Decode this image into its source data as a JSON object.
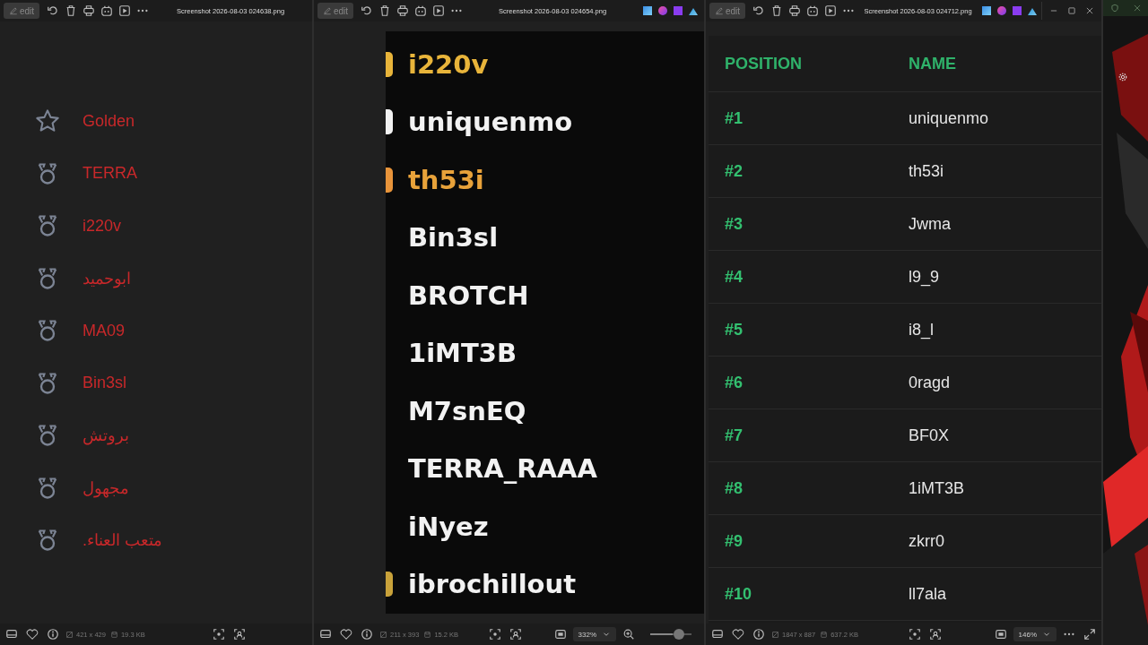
{
  "windows": [
    {
      "kind": "medals",
      "title": "Screenshot 2026-08-03 024638.png",
      "edit_label": "edit",
      "entries": [
        {
          "kind": "star",
          "name": "Golden"
        },
        {
          "kind": "medal",
          "name": "TERRA"
        },
        {
          "kind": "medal",
          "name": "i220v"
        },
        {
          "kind": "medal",
          "name": "ابوحميد"
        },
        {
          "kind": "medal",
          "name": "MA09"
        },
        {
          "kind": "medal",
          "name": "Bin3sl"
        },
        {
          "kind": "medal",
          "name": "بروتش"
        },
        {
          "kind": "medal",
          "name": "مجهول"
        },
        {
          "kind": "medal",
          "name": "متعب العناء."
        }
      ],
      "dimensions": "421 x 429",
      "file_size": "19.3 KB"
    },
    {
      "kind": "names",
      "title": "Screenshot 2026-08-03 024654.png",
      "edit_label": "edit",
      "app_shortcuts": true,
      "names": [
        {
          "name": "i220v",
          "color": "#e8b43a",
          "badge": {
            "color": "#e8b43a"
          }
        },
        {
          "name": "uniquenmo",
          "color": "#f2f2f2",
          "badge": {
            "color": "#f2f2f2"
          }
        },
        {
          "name": "th53i",
          "color": "#e8a23a",
          "badge": {
            "color": "#e8943a"
          }
        },
        {
          "name": "Bin3sl",
          "color": "#f2f2f2"
        },
        {
          "name": "BROTCH",
          "color": "#f2f2f2"
        },
        {
          "name": "1iMT3B",
          "color": "#f2f2f2"
        },
        {
          "name": "M7snEQ",
          "color": "#f2f2f2"
        },
        {
          "name": "TERRA_RAAA",
          "color": "#f2f2f2"
        },
        {
          "name": "iNyez",
          "color": "#f2f2f2"
        },
        {
          "name": "ibrochillout",
          "color": "#f2f2f2",
          "badge": {
            "color": "#c9a23a"
          }
        }
      ],
      "dimensions": "211 x 393",
      "file_size": "15.2 KB",
      "zoom": "332%",
      "zoom_slider": {
        "level": 0.55
      }
    },
    {
      "kind": "table",
      "title": "Screenshot 2026-08-03 024712.png",
      "edit_label": "edit",
      "app_shortcuts": true,
      "window_controls": true,
      "table": {
        "columns": [
          "POSITION",
          "NAME"
        ],
        "rows": [
          [
            "#1",
            "uniquenmo"
          ],
          [
            "#2",
            "th53i"
          ],
          [
            "#3",
            "Jwma"
          ],
          [
            "#4",
            "l9_9"
          ],
          [
            "#5",
            "i8_l"
          ],
          [
            "#6",
            "0ragd"
          ],
          [
            "#7",
            "BF0X"
          ],
          [
            "#8",
            "1iMT3B"
          ],
          [
            "#9",
            "zkrr0"
          ],
          [
            "#10",
            "ll7ala"
          ]
        ]
      },
      "dimensions": "1847 x 887",
      "file_size": "637.2 KB",
      "zoom": "146%"
    }
  ]
}
